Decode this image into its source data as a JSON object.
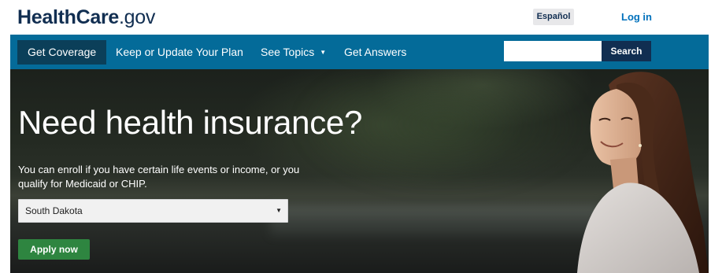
{
  "header": {
    "logo_main": "HealthCare",
    "logo_dot": ".",
    "logo_suffix": "gov",
    "language_button": "Español",
    "login_link": "Log in"
  },
  "nav": {
    "items": [
      {
        "label": "Get Coverage",
        "active": true
      },
      {
        "label": "Keep or Update Your Plan",
        "active": false
      },
      {
        "label": "See Topics",
        "active": false,
        "has_dropdown": true
      },
      {
        "label": "Get Answers",
        "active": false
      }
    ],
    "search_value": "",
    "search_button": "Search"
  },
  "hero": {
    "heading": "Need health insurance?",
    "text": "You can enroll if you have certain life events or income, or you qualify for Medicaid or CHIP.",
    "state_selected": "South Dakota",
    "apply_button": "Apply now"
  },
  "colors": {
    "brand_navy": "#112e51",
    "nav_blue": "#046b99",
    "nav_active": "#0b3f59",
    "link_blue": "#0071bc",
    "apply_green": "#2e8540"
  },
  "icons": {
    "dropdown": "chevron-down-icon"
  }
}
